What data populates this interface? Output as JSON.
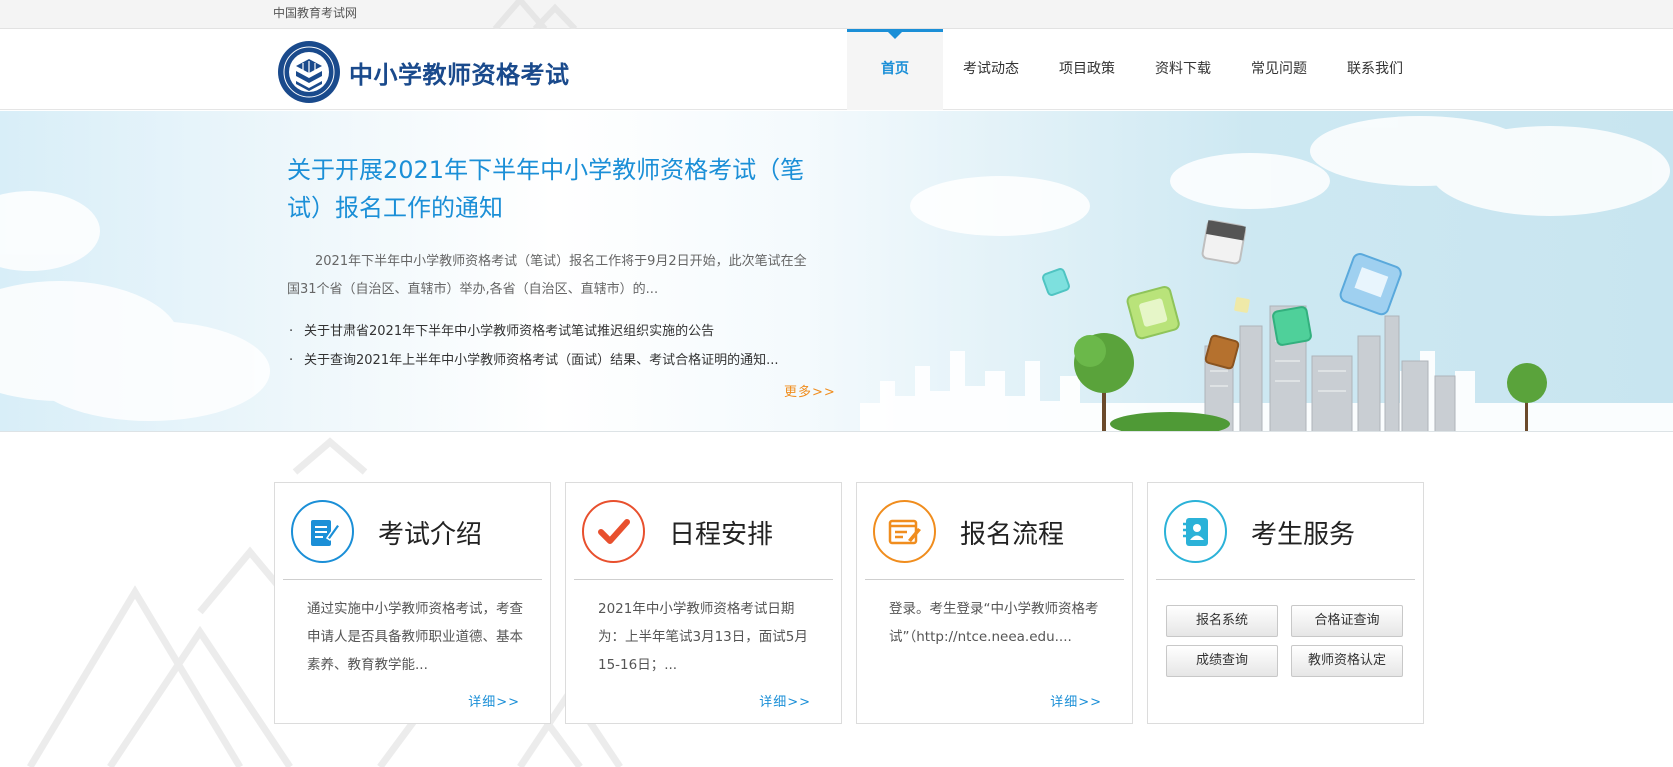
{
  "topbar": {
    "link": "中国教育考试网"
  },
  "header": {
    "site_title": "中小学教师资格考试",
    "nav": [
      {
        "label": "首页",
        "active": true
      },
      {
        "label": "考试动态",
        "active": false
      },
      {
        "label": "项目政策",
        "active": false
      },
      {
        "label": "资料下载",
        "active": false
      },
      {
        "label": "常见问题",
        "active": false
      },
      {
        "label": "联系我们",
        "active": false
      }
    ]
  },
  "banner": {
    "headline": "关于开展2021年下半年中小学教师资格考试（笔试）报名工作的通知",
    "summary": "2021年下半年中小学教师资格考试（笔试）报名工作将于9月2日开始，此次笔试在全国31个省（自治区、直辖市）举办,各省（自治区、直辖市）的...",
    "news": [
      "关于甘肃省2021年下半年中小学教师资格考试笔试推迟组织实施的公告",
      "关于查询2021年上半年中小学教师资格考试（面试）结果、考试合格证明的通知..."
    ],
    "bullet": "·",
    "more": "更多>>"
  },
  "cards": {
    "intro": {
      "title": "考试介绍",
      "icon": "document-edit-icon",
      "text": "通过实施中小学教师资格考试，考查申请人是否具备教师职业道德、基本素养、教育教学能...",
      "more": "详细>>",
      "color": "#1b8fd7"
    },
    "schedule": {
      "title": "日程安排",
      "icon": "checkmark-icon",
      "text": "2021年中小学教师资格考试日期为：上半年笔试3月13日，面试5月15-16日；...",
      "more": "详细>>",
      "color": "#e8502e"
    },
    "process": {
      "title": "报名流程",
      "icon": "form-edit-icon",
      "text": "登录。考生登录“中小学教师资格考试”（http://ntce.neea.edu....",
      "more": "详细>>",
      "color": "#f08d1e"
    },
    "service": {
      "title": "考生服务",
      "icon": "contact-book-icon",
      "color": "#2bb2d8",
      "buttons": [
        "报名系统",
        "合格证查询",
        "成绩查询",
        "教师资格认定"
      ]
    }
  }
}
